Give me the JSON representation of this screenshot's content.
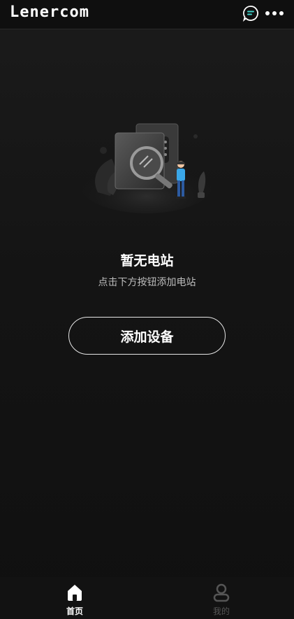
{
  "app": {
    "logo_text": "Lenercom"
  },
  "header": {
    "message_icon": "chat-bubble-icon",
    "more_icon": "more-dots-icon"
  },
  "empty_state": {
    "illustration": "device-search-illustration",
    "title": "暂无电站",
    "subtitle": "点击下方按钮添加电站"
  },
  "actions": {
    "add_device_label": "添加设备"
  },
  "tabbar": {
    "home_label": "首页",
    "mine_label": "我的",
    "active_tab": "首页"
  },
  "colors": {
    "background": "#121212",
    "accent_teal": "#3fd1c8",
    "figure_blue": "#3aa7e8"
  }
}
